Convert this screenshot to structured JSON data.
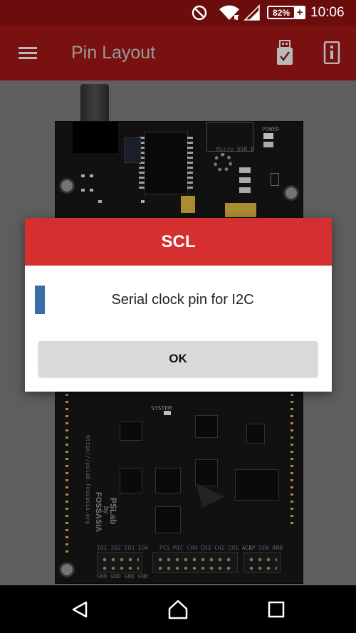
{
  "status_bar": {
    "battery_percent": "82%",
    "battery_level": 0.82,
    "battery_charging": true,
    "time": "10:06",
    "icons": [
      "do-not-disturb-icon",
      "wifi-icon",
      "cellular-signal-icon",
      "battery-icon",
      "battery-charging-icon"
    ]
  },
  "toolbar": {
    "title": "Pin Layout",
    "menu_icon": "menu-icon",
    "action_icons": [
      "usb-connected-icon",
      "info-card-icon"
    ]
  },
  "board": {
    "labels": {
      "power": "POWER",
      "system": "SYSTEM",
      "brand_line1": "PSLab",
      "brand_line2": "by",
      "brand_line3": "FOSSASIA",
      "url": "https://pslab.fossasia.org",
      "micro_usb": "Micro USB B",
      "bottom_header_1": "IO1  IO2  IO3  IO4",
      "bottom_header_2": "PCS  MIC  CH4  CH3  CH2  CH1  ACE",
      "bottom_header_3": "CAP  SEN  AN8",
      "bottom_gnd": "GND  GND  GND  GND"
    }
  },
  "dialog": {
    "title": "SCL",
    "message": "Serial clock pin for I2C",
    "pin_color": "#3a6ea5",
    "ok_label": "OK"
  },
  "colors": {
    "status_bar": "#6b0d0d",
    "toolbar": "#7a1111",
    "dialog_header": "#d62f2f",
    "ok_button": "#d9d9d9"
  }
}
